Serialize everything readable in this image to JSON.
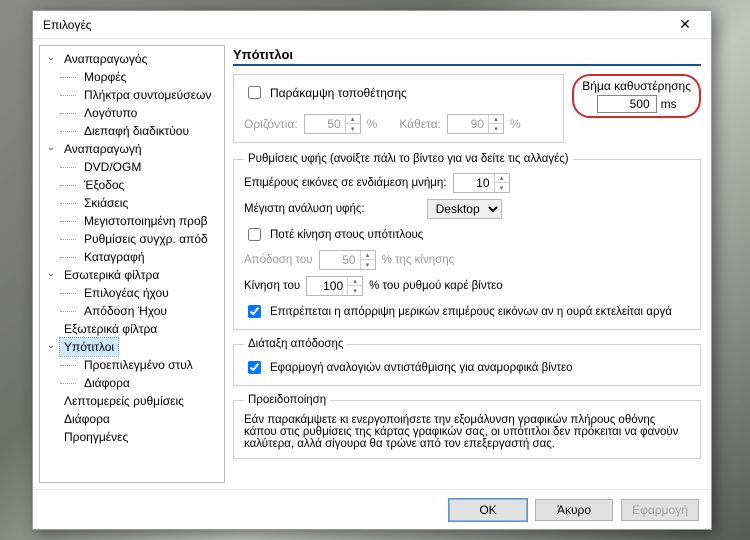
{
  "dialog": {
    "title": "Επιλογές"
  },
  "tree": {
    "items": [
      {
        "label": "Αναπαραγωγός",
        "expanded": true,
        "depth": 0,
        "has_children": true
      },
      {
        "label": "Μορφές",
        "depth": 1
      },
      {
        "label": "Πλήκτρα συντομεύσεων",
        "depth": 1
      },
      {
        "label": "Λογότυπο",
        "depth": 1
      },
      {
        "label": "Διεπαφή διαδικτύου",
        "depth": 1
      },
      {
        "label": "Αναπαραγωγή",
        "expanded": true,
        "depth": 0,
        "has_children": true
      },
      {
        "label": "DVD/OGM",
        "depth": 1
      },
      {
        "label": "Έξοδος",
        "depth": 1
      },
      {
        "label": "Σκιάσεις",
        "depth": 1
      },
      {
        "label": "Μεγιστοποιημένη προβ",
        "depth": 1
      },
      {
        "label": "Ρυθμίσεις συγχρ. απόδ",
        "depth": 1
      },
      {
        "label": "Καταγραφή",
        "depth": 1
      },
      {
        "label": "Εσωτερικά φίλτρα",
        "expanded": true,
        "depth": 0,
        "has_children": true
      },
      {
        "label": "Επιλογέας ήχου",
        "depth": 1
      },
      {
        "label": "Απόδοση Ήχου",
        "depth": 1
      },
      {
        "label": "Εξωτερικά φίλτρα",
        "depth": 0,
        "has_children": false
      },
      {
        "label": "Υπότιτλοι",
        "depth": 0,
        "expanded": true,
        "has_children": true,
        "selected": true
      },
      {
        "label": "Προεπιλεγμένο στυλ",
        "depth": 1
      },
      {
        "label": "Διάφορα",
        "depth": 1
      },
      {
        "label": "Λεπτομερείς ρυθμίσεις",
        "depth": 0,
        "has_children": false
      },
      {
        "label": "Διάφορα",
        "depth": 0,
        "has_children": false
      },
      {
        "label": "Προηγμένες",
        "depth": 0,
        "has_children": false
      }
    ]
  },
  "section": {
    "title": "Υπότιτλοι"
  },
  "override": {
    "checkbox_label": "Παράκαμψη τοποθέτησης",
    "checked": false,
    "horiz_label": "Οριζόντια:",
    "horiz_value": "50",
    "vert_label": "Κάθετα:",
    "vert_value": "90",
    "pct": "%"
  },
  "delay_step": {
    "label": "Βήμα καθυστέρησης",
    "value": "500",
    "unit": "ms"
  },
  "texture": {
    "legend": "Ρυθμίσεις υφής (ανοίξτε πάλι το βίντεο για να δείτε τις αλλαγές)",
    "buffers_label": "Επιμέρους εικόνες σε ενδιάμεση μνήμη:",
    "buffers_value": "10",
    "maxres_label": "Μέγιστη ανάλυση υφής:",
    "maxres_value": "Desktop",
    "neveranim_label": "Ποτέ κίνηση στους υπότιτλους",
    "neveranim_checked": false,
    "renderat_label": "Απόδοση του",
    "renderat_value": "50",
    "renderat_suffix": "% της κίνησης",
    "animat_label": "Κίνηση του",
    "animat_value": "100",
    "animat_suffix": "% του ρυθμού καρέ βίντεο",
    "allowdrop_label": "Επιτρέπεται η απόρριψη μερικών επιμέρους εικόνων αν η ουρά εκτελείται αργά",
    "allowdrop_checked": true
  },
  "renderlayout": {
    "legend": "Διάταξη απόδοσης",
    "anamorphic_label": "Εφαρμογή αναλογιών αντιστάθμισης για αναμορφικά βίντεο",
    "anamorphic_checked": true
  },
  "warning": {
    "legend": "Προειδοποίηση",
    "text": "Εάν παρακάμψετε κι ενεργοποιήσετε την εξομάλυνση γραφικών πλήρους οθόνης κάπου στις ρυθμίσεις της κάρτας γραφικών σας, οι υπότιτλοι δεν πρόκειται να φανούν καλύτερα, αλλά σίγουρα θα τρώνε από τον επεξεργαστή σας."
  },
  "buttons": {
    "ok": "OK",
    "cancel": "Άκυρο",
    "apply": "Εφαρμογή"
  }
}
